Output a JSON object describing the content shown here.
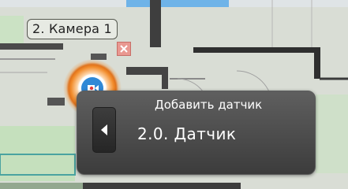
{
  "map": {
    "camera_label": "2. Камера 1"
  },
  "popup": {
    "title": "Добавить датчик",
    "sensor_label": "2.0. Датчик"
  },
  "colors": {
    "marker_ring": "#f28c2b",
    "camera_icon": "#2f88d6",
    "close_button": "#e99891",
    "popup_background": "#4a4a4a"
  },
  "icons": {
    "camera": "video-camera-icon",
    "close": "close-icon",
    "arrow": "left-arrow-icon"
  }
}
